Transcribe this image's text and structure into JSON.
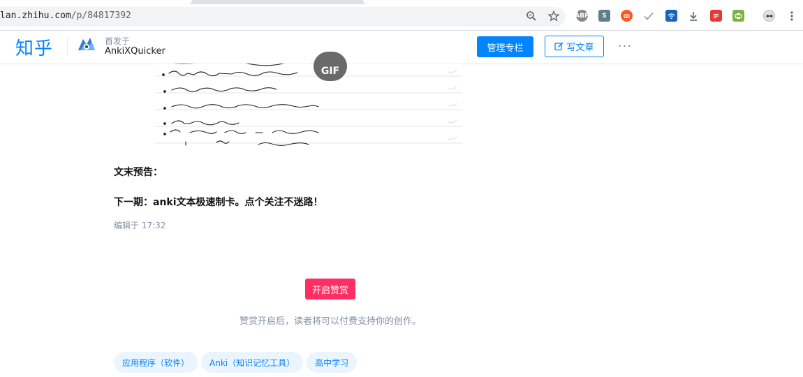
{
  "browser": {
    "url_host": "lan.zhihu.com",
    "url_path": "/p/84817392",
    "icons": [
      "zoom-icon",
      "star-icon",
      "abp-icon",
      "s-icon",
      "infinity-icon",
      "check-icon",
      "wifi-icon",
      "download-icon",
      "note-icon",
      "print-icon",
      "profile-icon",
      "menu-icon"
    ],
    "ext_abp_label": "ABP",
    "ext_s_label": "S"
  },
  "header": {
    "logo": "知乎",
    "published_in_label": "首发于",
    "column_name": "AnkiXQuicker",
    "manage_button": "管理专栏",
    "write_button": "写文章",
    "more_label": "···"
  },
  "article": {
    "gif_badge": "GIF",
    "paragraph_1": "文末预告：",
    "paragraph_2": "下一期：anki文本极速制卡。点个关注不迷路！",
    "edited_time": "编辑于 17:32"
  },
  "reward": {
    "button": "开启赞赏",
    "description": "赞赏开启后，读者将可以付费支持你的创作。"
  },
  "tags": [
    {
      "label": "应用程序（软件）"
    },
    {
      "label": "Anki（知识记忆工具）"
    },
    {
      "label": "高中学习"
    }
  ],
  "colors": {
    "brand": "#0084ff",
    "reward": "#ff2e63",
    "muted": "#8590a6"
  }
}
